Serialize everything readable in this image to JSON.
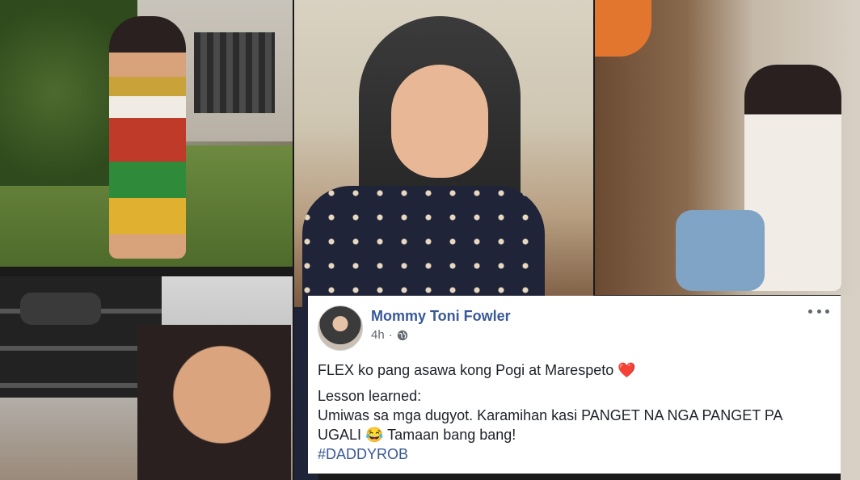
{
  "post": {
    "author": "Mommy Toni Fowler",
    "time": "4h",
    "separator": "·",
    "line1": "FLEX ko pang asawa kong Pogi at Marespeto",
    "heart": "❤️",
    "line2": "Lesson learned:",
    "line3": "Umiwas sa mga dugyot. Karamihan kasi PANGET NA NGA PANGET PA",
    "line4_start": "UGALI",
    "emoji": "😂",
    "line4_end": "Tamaan bang bang!",
    "hashtag": "#DADDYROB",
    "icons": {
      "privacy": "globe-icon",
      "options": "more-options-icon"
    }
  },
  "colors": {
    "link_blue": "#385898",
    "meta_gray": "#616770",
    "text": "#1d2129",
    "heart": "#e0245e"
  }
}
